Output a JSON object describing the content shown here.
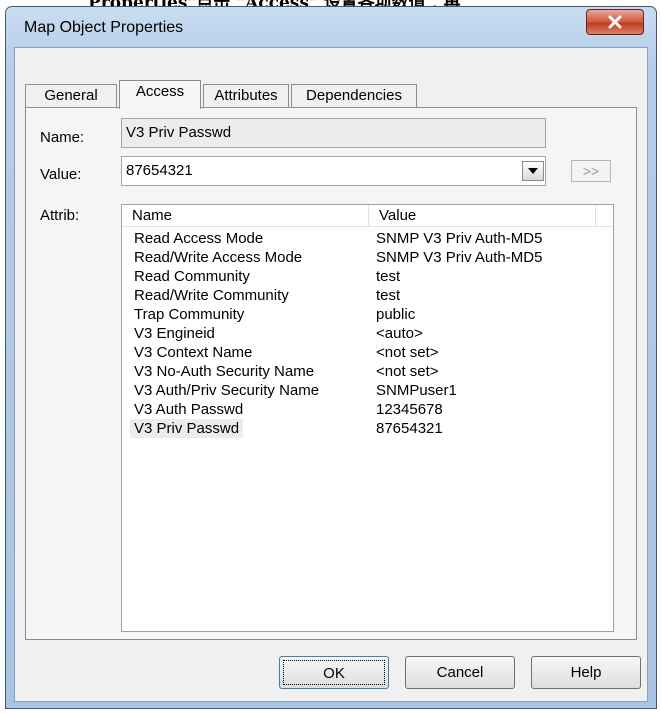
{
  "background_caption": "Properties\"点击 \"Access\" 设置各项数值 , 再",
  "window": {
    "title": "Map Object Properties",
    "close_icon": "close-x-icon"
  },
  "tabs": [
    {
      "label": "General",
      "active": false
    },
    {
      "label": "Access",
      "active": true
    },
    {
      "label": "Attributes",
      "active": false
    },
    {
      "label": "Dependencies",
      "active": false
    }
  ],
  "form": {
    "name_label": "Name:",
    "name_value": "V3 Priv Passwd",
    "value_label": "Value:",
    "value_value": "87654321",
    "dropdown_icon": "chevron-down-icon",
    "more_button_label": ">>",
    "attrib_label": "Attrib:"
  },
  "attrib_table": {
    "columns": [
      "Name",
      "Value"
    ],
    "rows": [
      {
        "name": "Read Access Mode",
        "value": "SNMP V3 Priv Auth-MD5"
      },
      {
        "name": "Read/Write Access Mode",
        "value": "SNMP V3 Priv Auth-MD5"
      },
      {
        "name": "Read Community",
        "value": "test"
      },
      {
        "name": "Read/Write Community",
        "value": "test"
      },
      {
        "name": "Trap Community",
        "value": "public"
      },
      {
        "name": "V3 Engineid",
        "value": "<auto>"
      },
      {
        "name": "V3 Context Name",
        "value": "<not set>"
      },
      {
        "name": "V3 No-Auth Security Name",
        "value": "<not set>"
      },
      {
        "name": "V3 Auth/Priv Security Name",
        "value": "SNMPuser1"
      },
      {
        "name": "V3 Auth Passwd",
        "value": "12345678"
      },
      {
        "name": "V3 Priv Passwd",
        "value": "87654321"
      }
    ],
    "selected_row": "V3 Priv Passwd"
  },
  "buttons": {
    "ok": "OK",
    "cancel": "Cancel",
    "help": "Help"
  }
}
